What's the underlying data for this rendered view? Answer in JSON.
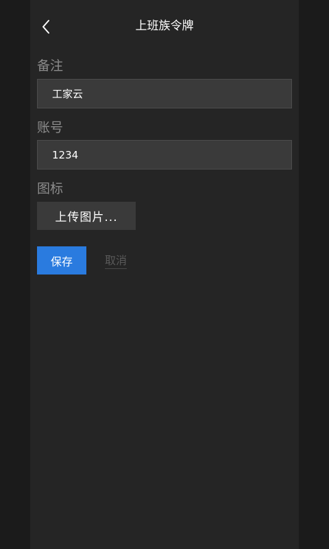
{
  "header": {
    "title": "上班族令牌",
    "back_icon": "chevron-left-icon"
  },
  "form": {
    "remark": {
      "label": "备注",
      "value": "工家云"
    },
    "account": {
      "label": "账号",
      "value": "1234"
    },
    "icon": {
      "label": "图标",
      "upload_label": "上传图片..."
    },
    "save_label": "保存",
    "cancel_label": "取消"
  },
  "colors": {
    "background": "#1b1b1b",
    "panel": "#252525",
    "input": "#3a3a3a",
    "accent": "#2a7bdf",
    "label": "#8c8c8c"
  }
}
